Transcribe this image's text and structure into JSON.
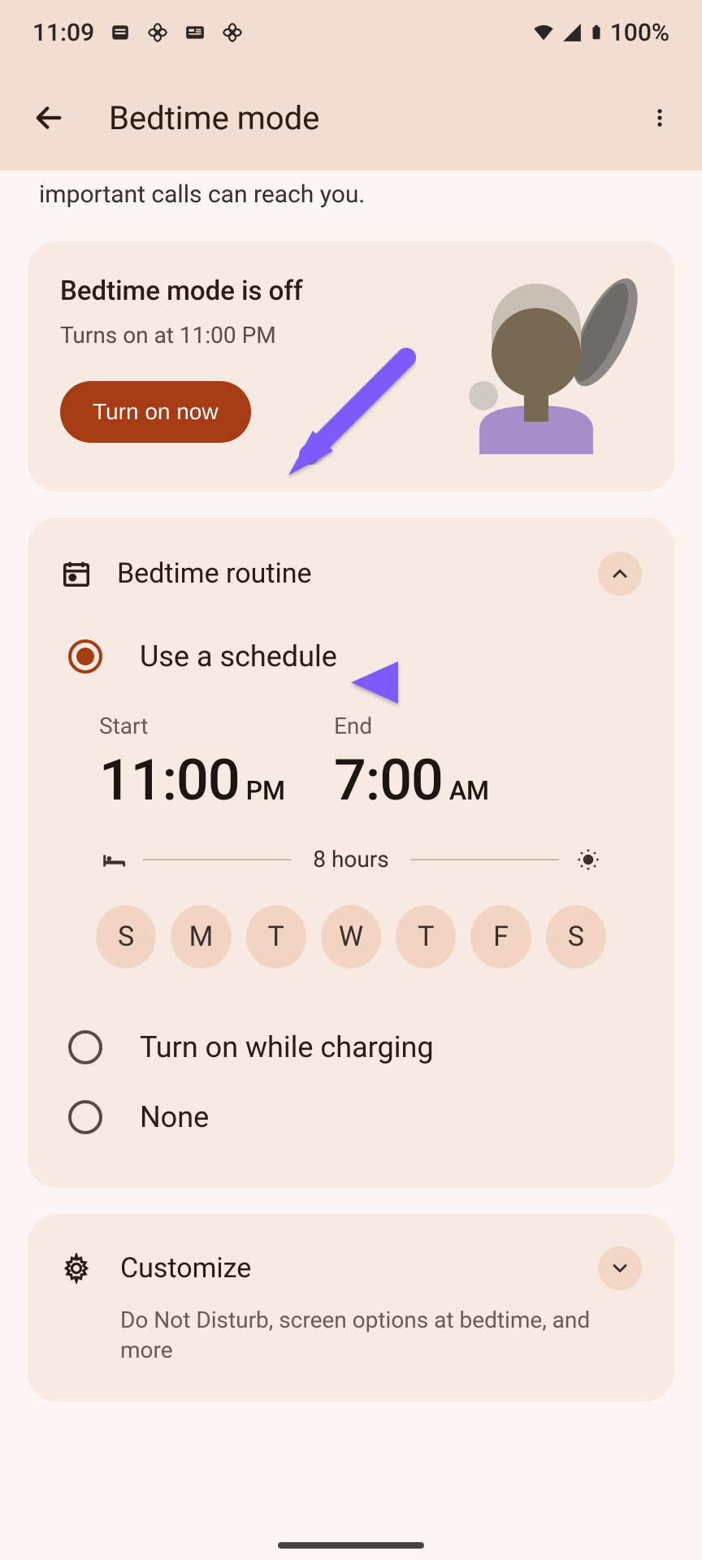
{
  "status_bar": {
    "time": "11:09",
    "battery": "100%"
  },
  "app_bar": {
    "title": "Bedtime mode"
  },
  "intro": {
    "text": "important calls can reach you."
  },
  "status_card": {
    "title": "Bedtime mode is off",
    "subtitle": "Turns on at 11:00 PM",
    "button": "Turn on now"
  },
  "routine": {
    "header": "Bedtime routine",
    "options": {
      "schedule": "Use a schedule",
      "charging": "Turn on while charging",
      "none": "None"
    },
    "start_label": "Start",
    "end_label": "End",
    "start_time": "11:00",
    "start_ampm": "PM",
    "end_time": "7:00",
    "end_ampm": "AM",
    "duration": "8 hours",
    "days": [
      "S",
      "M",
      "T",
      "W",
      "T",
      "F",
      "S"
    ]
  },
  "customize": {
    "title": "Customize",
    "subtitle": "Do Not Disturb, screen options at bedtime, and more"
  }
}
